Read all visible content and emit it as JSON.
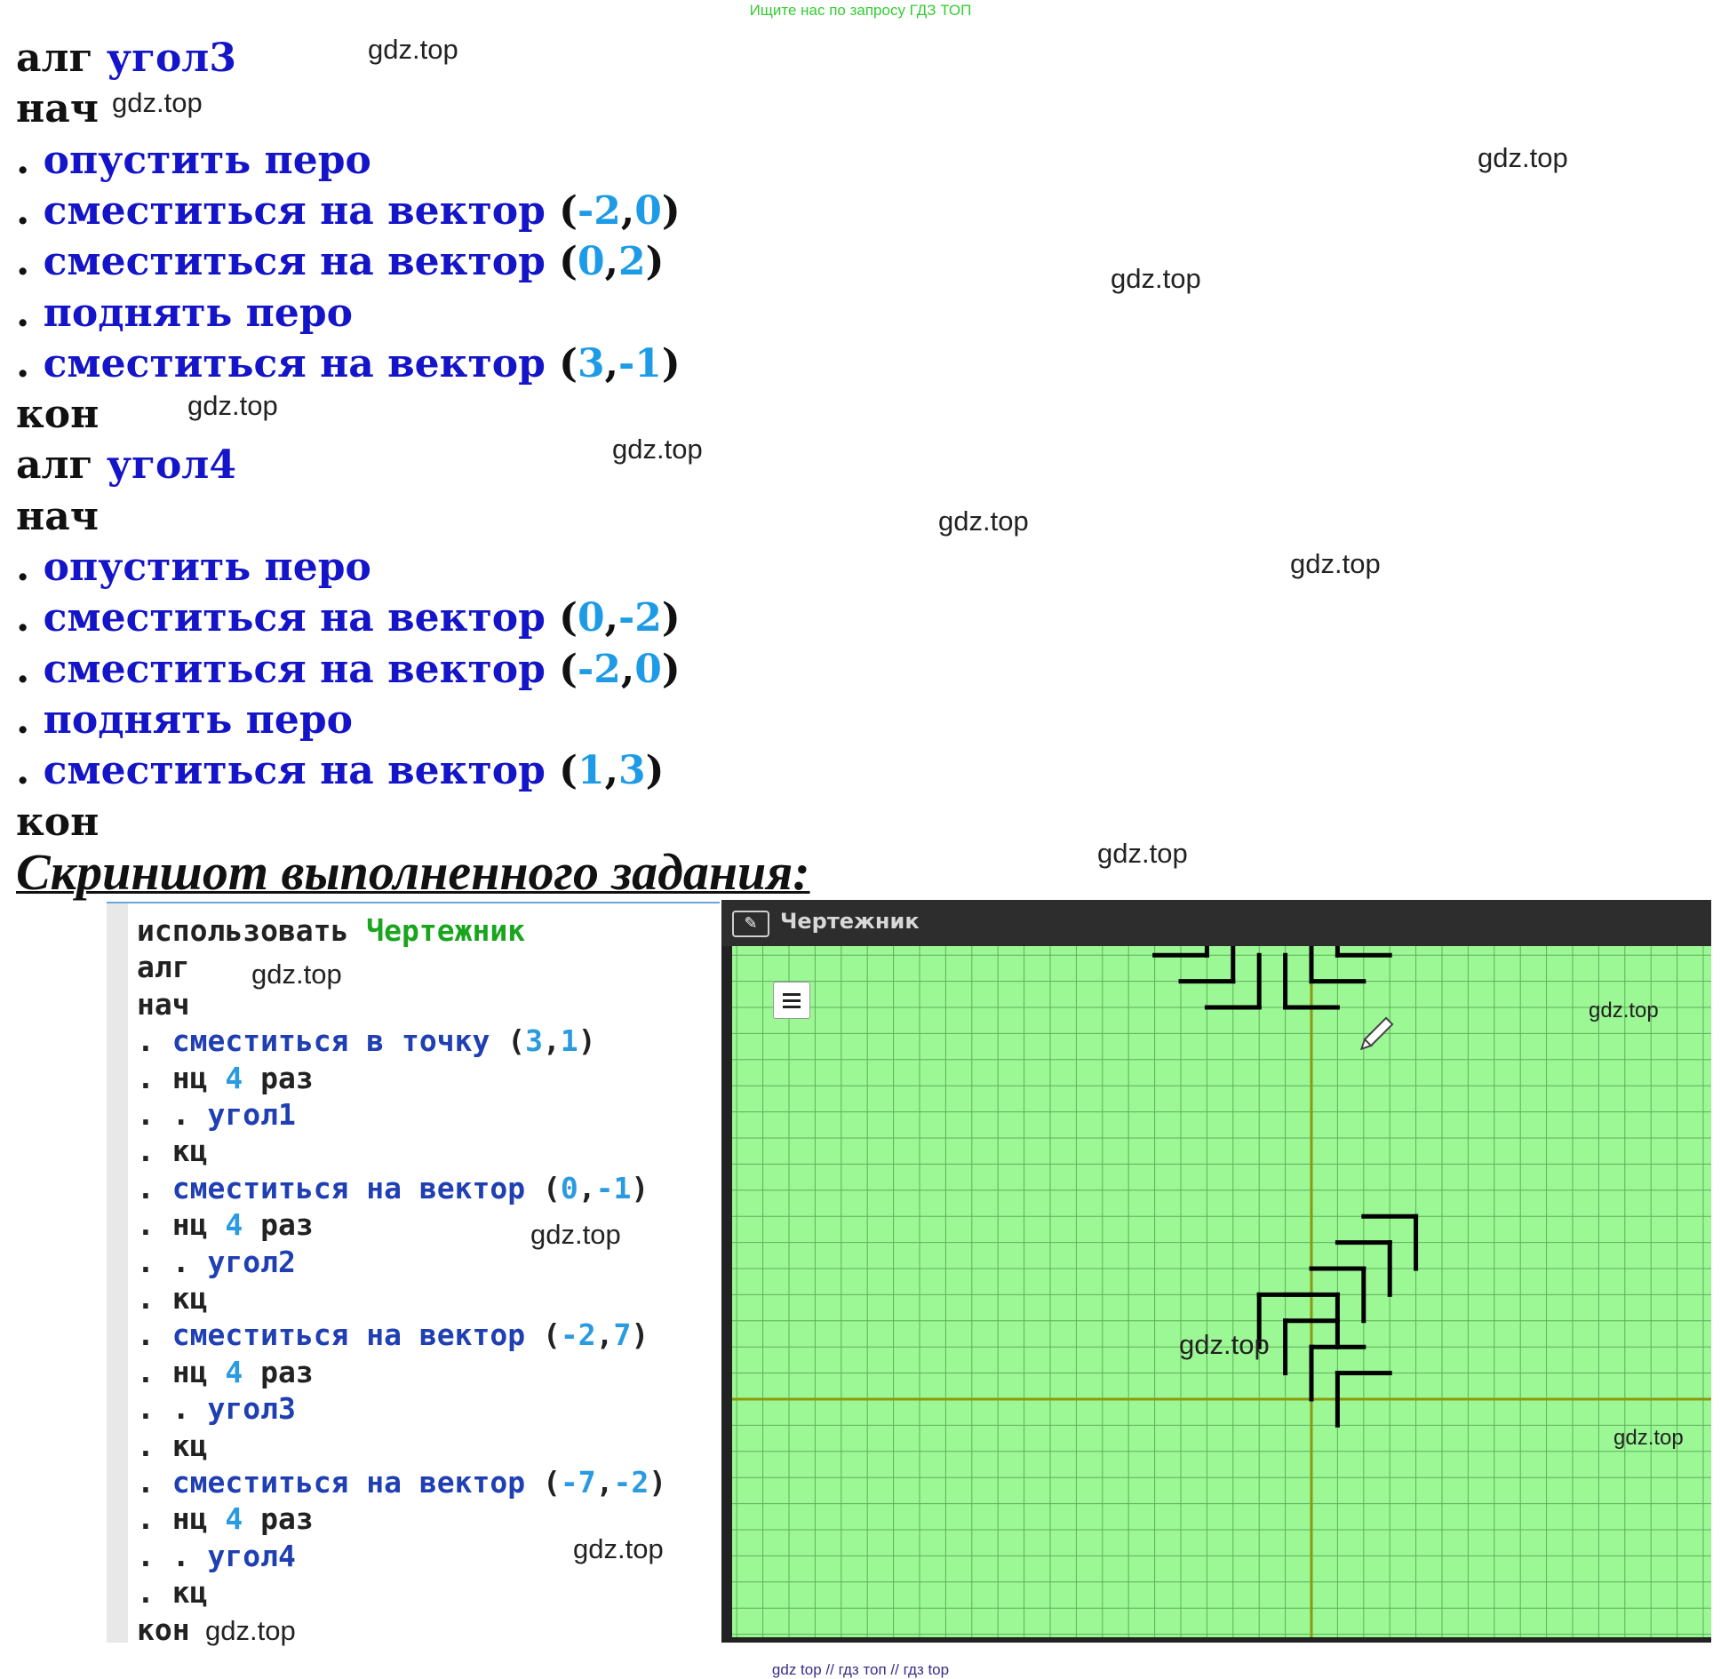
{
  "top_note": "Ищите нас по запросу ГДЗ ТОП",
  "watermark": "gdz.top",
  "code_lines": [
    {
      "tokens": [
        {
          "t": "алг ",
          "c": "kw"
        },
        {
          "t": "угол3",
          "c": "fn"
        }
      ]
    },
    {
      "tokens": [
        {
          "t": "нач",
          "c": "kw"
        }
      ]
    },
    {
      "tokens": [
        {
          "t": ". ",
          "c": "dot"
        },
        {
          "t": "опустить перо",
          "c": "fn"
        }
      ]
    },
    {
      "tokens": [
        {
          "t": ". ",
          "c": "dot"
        },
        {
          "t": "сместиться на вектор ",
          "c": "fn"
        },
        {
          "t": "(",
          "c": "kw"
        },
        {
          "t": "-2",
          "c": "num"
        },
        {
          "t": ",",
          "c": "kw"
        },
        {
          "t": "0",
          "c": "num"
        },
        {
          "t": ")",
          "c": "kw"
        }
      ]
    },
    {
      "tokens": [
        {
          "t": ". ",
          "c": "dot"
        },
        {
          "t": "сместиться на вектор ",
          "c": "fn"
        },
        {
          "t": "(",
          "c": "kw"
        },
        {
          "t": "0",
          "c": "num"
        },
        {
          "t": ",",
          "c": "kw"
        },
        {
          "t": "2",
          "c": "num"
        },
        {
          "t": ")",
          "c": "kw"
        }
      ]
    },
    {
      "tokens": [
        {
          "t": ". ",
          "c": "dot"
        },
        {
          "t": "поднять перо",
          "c": "fn"
        }
      ]
    },
    {
      "tokens": [
        {
          "t": ". ",
          "c": "dot"
        },
        {
          "t": "сместиться на вектор ",
          "c": "fn"
        },
        {
          "t": "(",
          "c": "kw"
        },
        {
          "t": "3",
          "c": "num"
        },
        {
          "t": ",",
          "c": "kw"
        },
        {
          "t": "-1",
          "c": "num"
        },
        {
          "t": ")",
          "c": "kw"
        }
      ]
    },
    {
      "tokens": [
        {
          "t": "кон",
          "c": "kw"
        }
      ]
    },
    {
      "tokens": [
        {
          "t": "алг ",
          "c": "kw"
        },
        {
          "t": "угол4",
          "c": "fn"
        }
      ]
    },
    {
      "tokens": [
        {
          "t": "нач",
          "c": "kw"
        }
      ]
    },
    {
      "tokens": [
        {
          "t": ". ",
          "c": "dot"
        },
        {
          "t": "опустить перо",
          "c": "fn"
        }
      ]
    },
    {
      "tokens": [
        {
          "t": ". ",
          "c": "dot"
        },
        {
          "t": "сместиться на вектор ",
          "c": "fn"
        },
        {
          "t": "(",
          "c": "kw"
        },
        {
          "t": "0",
          "c": "num"
        },
        {
          "t": ",",
          "c": "kw"
        },
        {
          "t": "-2",
          "c": "num"
        },
        {
          "t": ")",
          "c": "kw"
        }
      ]
    },
    {
      "tokens": [
        {
          "t": ". ",
          "c": "dot"
        },
        {
          "t": "сместиться на вектор ",
          "c": "fn"
        },
        {
          "t": "(",
          "c": "kw"
        },
        {
          "t": "-2",
          "c": "num"
        },
        {
          "t": ",",
          "c": "kw"
        },
        {
          "t": "0",
          "c": "num"
        },
        {
          "t": ")",
          "c": "kw"
        }
      ]
    },
    {
      "tokens": [
        {
          "t": ". ",
          "c": "dot"
        },
        {
          "t": "поднять перо",
          "c": "fn"
        }
      ]
    },
    {
      "tokens": [
        {
          "t": ". ",
          "c": "dot"
        },
        {
          "t": "сместиться на вектор ",
          "c": "fn"
        },
        {
          "t": "(",
          "c": "kw"
        },
        {
          "t": "1",
          "c": "num"
        },
        {
          "t": ",",
          "c": "kw"
        },
        {
          "t": "3",
          "c": "num"
        },
        {
          "t": ")",
          "c": "kw"
        }
      ]
    },
    {
      "tokens": [
        {
          "t": "кон",
          "c": "kw"
        }
      ]
    }
  ],
  "heading": "Скриншот выполненного задания:",
  "editor": {
    "lines": [
      {
        "tokens": [
          {
            "t": "использовать ",
            "c": "e-kw"
          },
          {
            "t": "Чертежник",
            "c": "e-mod"
          }
        ]
      },
      {
        "tokens": [
          {
            "t": "алг",
            "c": "e-kw"
          }
        ]
      },
      {
        "tokens": [
          {
            "t": "нач",
            "c": "e-kw"
          }
        ]
      },
      {
        "tokens": [
          {
            "t": ". ",
            "c": "e-kw"
          },
          {
            "t": "сместиться в точку ",
            "c": "e-fn"
          },
          {
            "t": "(",
            "c": "e-kw"
          },
          {
            "t": "3",
            "c": "e-num"
          },
          {
            "t": ",",
            "c": "e-kw"
          },
          {
            "t": "1",
            "c": "e-num"
          },
          {
            "t": ")",
            "c": "e-kw"
          }
        ]
      },
      {
        "tokens": [
          {
            "t": ". нц ",
            "c": "e-kw"
          },
          {
            "t": "4",
            "c": "e-num"
          },
          {
            "t": " раз",
            "c": "e-kw"
          }
        ]
      },
      {
        "tokens": [
          {
            "t": ". . ",
            "c": "e-kw"
          },
          {
            "t": "угол1",
            "c": "e-fn"
          }
        ]
      },
      {
        "tokens": [
          {
            "t": ". кц",
            "c": "e-kw"
          }
        ]
      },
      {
        "tokens": [
          {
            "t": ". ",
            "c": "e-kw"
          },
          {
            "t": "сместиться на вектор ",
            "c": "e-fn"
          },
          {
            "t": "(",
            "c": "e-kw"
          },
          {
            "t": "0",
            "c": "e-num"
          },
          {
            "t": ",",
            "c": "e-kw"
          },
          {
            "t": "-1",
            "c": "e-num"
          },
          {
            "t": ")",
            "c": "e-kw"
          }
        ]
      },
      {
        "tokens": [
          {
            "t": ". нц ",
            "c": "e-kw"
          },
          {
            "t": "4",
            "c": "e-num"
          },
          {
            "t": " раз",
            "c": "e-kw"
          }
        ]
      },
      {
        "tokens": [
          {
            "t": ". . ",
            "c": "e-kw"
          },
          {
            "t": "угол2",
            "c": "e-fn"
          }
        ]
      },
      {
        "tokens": [
          {
            "t": ". кц",
            "c": "e-kw"
          }
        ]
      },
      {
        "tokens": [
          {
            "t": ". ",
            "c": "e-kw"
          },
          {
            "t": "сместиться на вектор ",
            "c": "e-fn"
          },
          {
            "t": "(",
            "c": "e-kw"
          },
          {
            "t": "-2",
            "c": "e-num"
          },
          {
            "t": ",",
            "c": "e-kw"
          },
          {
            "t": "7",
            "c": "e-num"
          },
          {
            "t": ")",
            "c": "e-kw"
          }
        ]
      },
      {
        "tokens": [
          {
            "t": ". нц ",
            "c": "e-kw"
          },
          {
            "t": "4",
            "c": "e-num"
          },
          {
            "t": " раз",
            "c": "e-kw"
          }
        ]
      },
      {
        "tokens": [
          {
            "t": ". . ",
            "c": "e-kw"
          },
          {
            "t": "угол3",
            "c": "e-fn"
          }
        ]
      },
      {
        "tokens": [
          {
            "t": ". кц",
            "c": "e-kw"
          }
        ]
      },
      {
        "tokens": [
          {
            "t": ". ",
            "c": "e-kw"
          },
          {
            "t": "сместиться на вектор ",
            "c": "e-fn"
          },
          {
            "t": "(",
            "c": "e-kw"
          },
          {
            "t": "-7",
            "c": "e-num"
          },
          {
            "t": ",",
            "c": "e-kw"
          },
          {
            "t": "-2",
            "c": "e-num"
          },
          {
            "t": ")",
            "c": "e-kw"
          }
        ]
      },
      {
        "tokens": [
          {
            "t": ". нц ",
            "c": "e-kw"
          },
          {
            "t": "4",
            "c": "e-num"
          },
          {
            "t": " раз",
            "c": "e-kw"
          }
        ]
      },
      {
        "tokens": [
          {
            "t": ". . ",
            "c": "e-kw"
          },
          {
            "t": "угол4",
            "c": "e-fn"
          }
        ]
      },
      {
        "tokens": [
          {
            "t": ". кц",
            "c": "e-kw"
          }
        ]
      },
      {
        "tokens": [
          {
            "t": "кон",
            "c": "e-kw"
          }
        ]
      }
    ]
  },
  "panel": {
    "title": "Чертежник",
    "pin_icon": "pin-icon",
    "menu_icon": "hamburger-menu-icon",
    "pen_icon": "pencil-icon",
    "colors": {
      "background": "#9cf795",
      "grid": "#5fb05a",
      "axis": "#8a9a10",
      "line": "#000000"
    }
  },
  "footer": "gdz top // гдз топ // гдз top"
}
